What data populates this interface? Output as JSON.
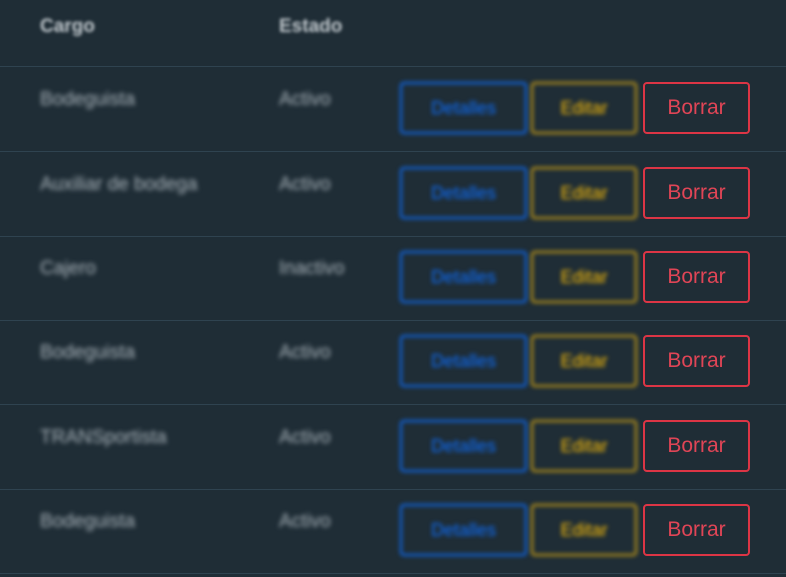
{
  "table": {
    "headers": {
      "cargo": "Cargo",
      "estado": "Estado"
    },
    "rows": [
      {
        "cargo": "Bodeguista",
        "estado": "Activo"
      },
      {
        "cargo": "Auxiliar de bodega",
        "estado": "Activo"
      },
      {
        "cargo": "Cajero",
        "estado": "Inactivo"
      },
      {
        "cargo": "Bodeguista",
        "estado": "Activo"
      },
      {
        "cargo": "TRANSportista",
        "estado": "Activo"
      },
      {
        "cargo": "Bodeguista",
        "estado": "Activo"
      }
    ],
    "actions": {
      "detalles": "Detalles",
      "editar": "Editar",
      "borrar": "Borrar"
    }
  },
  "colors": {
    "background": "#1f2d36",
    "detalles": "#0d6efd",
    "editar": "#ffc107",
    "borrar": "#dc3545"
  }
}
